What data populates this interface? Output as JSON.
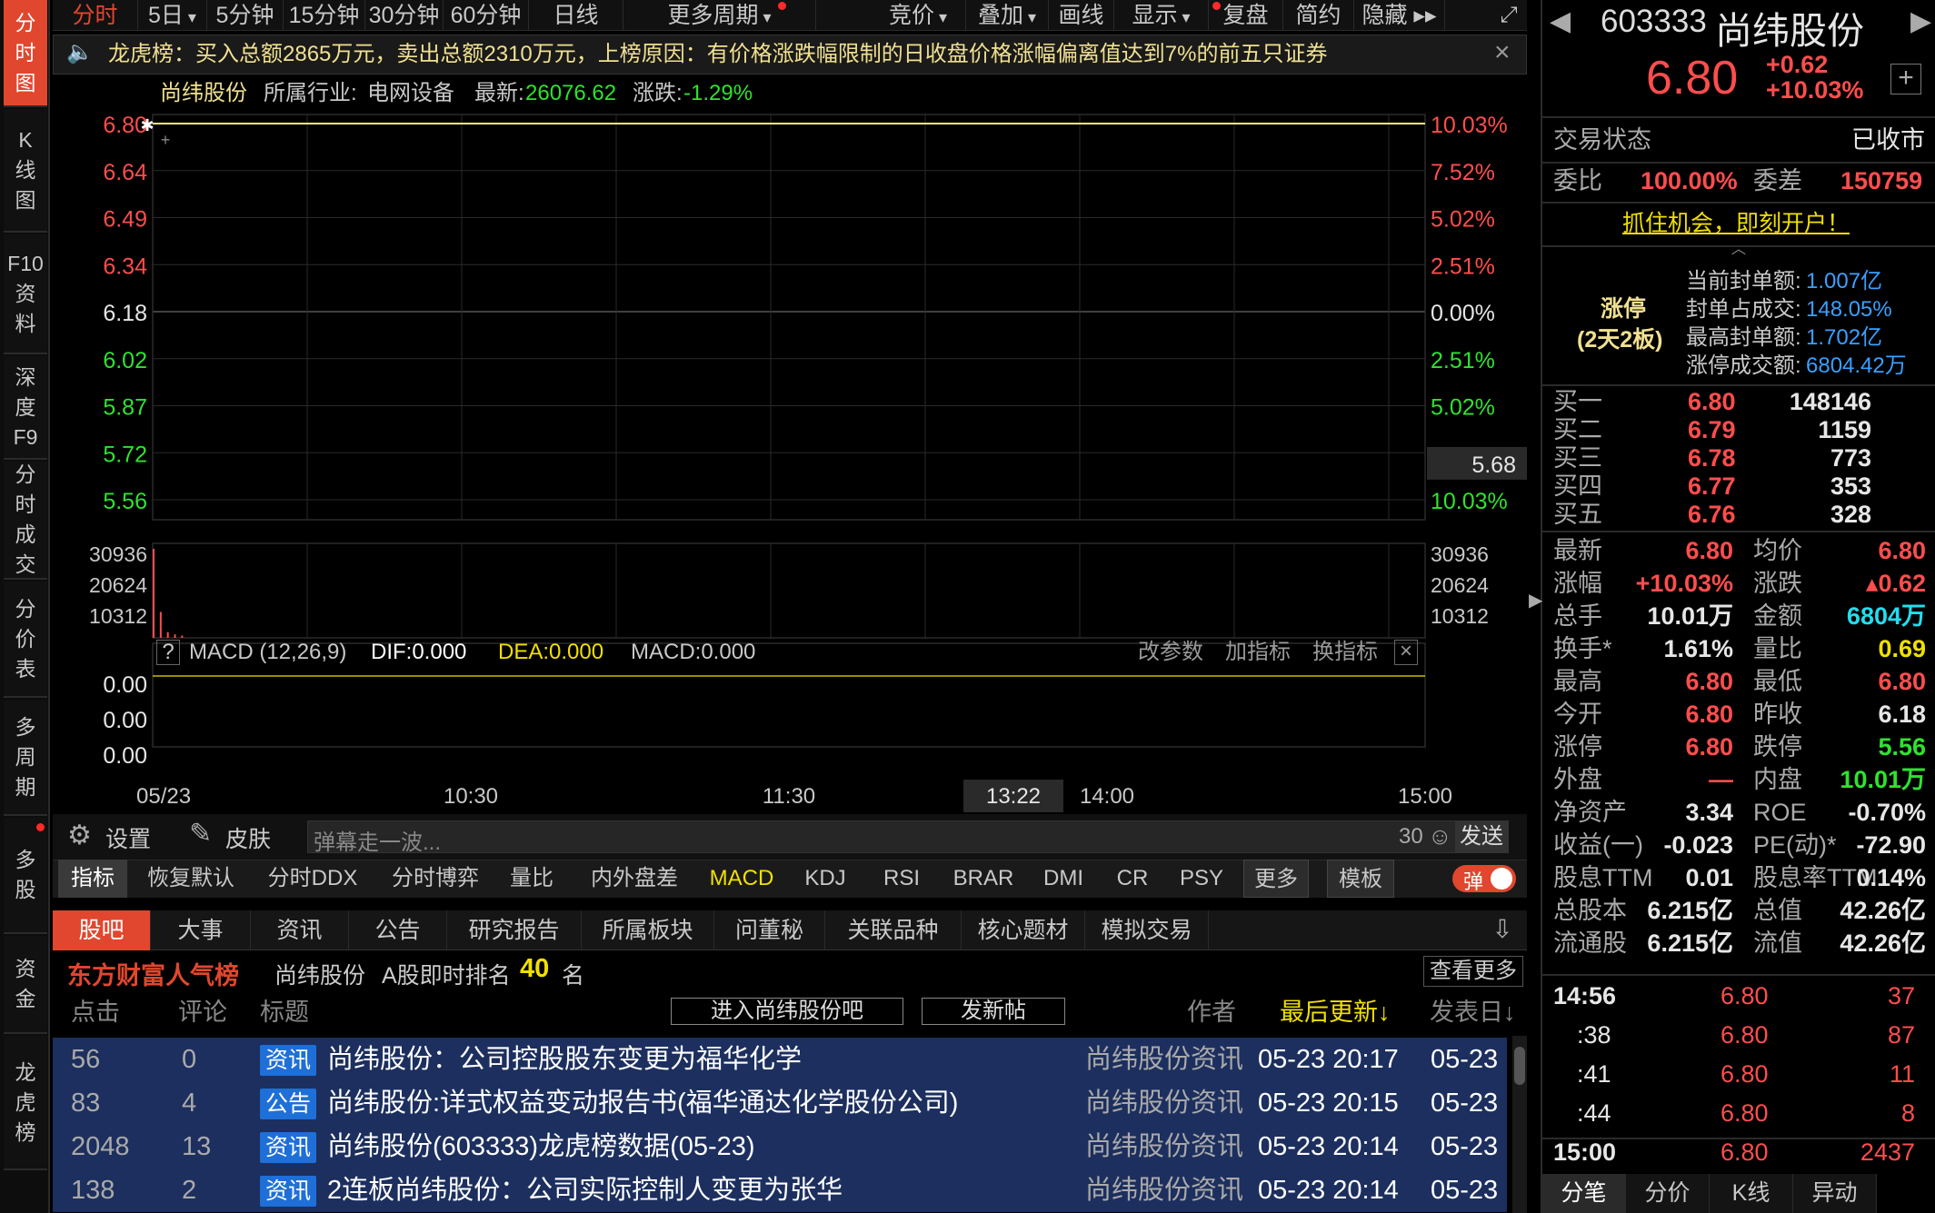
{
  "leftnav": [
    {
      "label": "分\n时\n图",
      "active": true
    },
    {
      "label": "K\n线\n图",
      "active": false
    },
    {
      "label": "F10\n资\n料",
      "active": false
    },
    {
      "label": "深\n度\nF9",
      "active": false
    },
    {
      "label": "分\n时\n成\n交",
      "active": false
    },
    {
      "label": "分\n价\n表",
      "active": false
    },
    {
      "label": "多\n周\n期",
      "active": false
    },
    {
      "label": "多\n股",
      "active": false
    },
    {
      "label": "资\n金",
      "active": false
    },
    {
      "label": "龙\n虎\n榜",
      "active": false
    }
  ],
  "toolbar": {
    "items": [
      "分时",
      "5日",
      "5分钟",
      "15分钟",
      "30分钟",
      "60分钟",
      "日线",
      "更多周期",
      "竞价",
      "叠加",
      "画线",
      "显示",
      "复盘",
      "简约",
      "隐藏 ▸▸"
    ],
    "active_index": 0
  },
  "banner": {
    "text": "龙虎榜：买入总额2865万元，卖出总额2310万元，上榜原因：有价格涨跌幅限制的日收盘价格涨幅偏离值达到7%的前五只证券"
  },
  "chart_header": {
    "name": "尚纬股份",
    "industry_label": "所属行业:",
    "industry": "电网设备",
    "latest_label": "最新:",
    "latest": "26076.62",
    "change_label": "涨跌:",
    "change": "-1.29%"
  },
  "chart_data": {
    "type": "line",
    "title": "尚纬股份 分时图",
    "y_price_ticks": [
      "6.80",
      "6.64",
      "6.49",
      "6.34",
      "6.18",
      "6.02",
      "5.87",
      "5.72",
      "5.56"
    ],
    "y_pct_ticks": [
      "10.03%",
      "7.52%",
      "5.02%",
      "2.51%",
      "0.00%",
      "2.51%",
      "5.02%",
      "10.03%"
    ],
    "ylim": [
      5.56,
      6.8
    ],
    "prev_close": 6.18,
    "price_series": [
      {
        "time": "09:30",
        "price": 6.8
      },
      {
        "time": "15:00",
        "price": 6.8
      }
    ],
    "cursor_price": "5.68",
    "volume_ticks": [
      "30936",
      "20624",
      "10312"
    ],
    "volume_max": 30936,
    "volume_bars": [
      {
        "time": "09:30",
        "value": 30936
      },
      {
        "time": "09:31",
        "value": 9000
      },
      {
        "time": "09:32",
        "value": 2000
      },
      {
        "time": "09:33",
        "value": 1200
      },
      {
        "time": "09:34",
        "value": 800
      }
    ],
    "macd_ticks": [
      "0.00",
      "0.00",
      "0.00"
    ],
    "macd_label": "MACD (12,26,9)",
    "dif": "DIF:0.000",
    "dea": "DEA:0.000",
    "macd": "MACD:0.000",
    "macd_links": [
      "改参数",
      "加指标",
      "换指标"
    ],
    "x_ticks": [
      "05/23",
      "10:30",
      "11:30",
      "14:00",
      "15:00"
    ],
    "x_cursor": "13:22"
  },
  "bottombar": {
    "settings": "设置",
    "skin": "皮肤",
    "danmu_placeholder": "弹幕走一波...",
    "count": "30",
    "send": "发送"
  },
  "indicators": {
    "items": [
      "指标",
      "恢复默认",
      "分时DDX",
      "分时博弈",
      "量比",
      "内外盘差",
      "MACD",
      "KDJ",
      "RSI",
      "BRAR",
      "DMI",
      "CR",
      "PSY",
      "更多",
      "模板"
    ],
    "active": "MACD",
    "toggle_label": "弹"
  },
  "news_tabs": {
    "items": [
      "股吧",
      "大事",
      "资讯",
      "公告",
      "研究报告",
      "所属板块",
      "问董秘",
      "关联品种",
      "核心题材",
      "模拟交易"
    ],
    "active_index": 0
  },
  "popularity": {
    "brand": "东方财富人气榜",
    "stock": "尚纬股份",
    "rank_label": "A股即时排名",
    "rank": "40",
    "rank_unit": "名",
    "more": "查看更多"
  },
  "news_header": {
    "clicks": "点击",
    "comments": "评论",
    "title": "标题",
    "enter_bar": "进入尚纬股份吧",
    "post": "发新帖",
    "author": "作者",
    "last_update": "最后更新↓",
    "post_date": "发表日↓"
  },
  "news_rows": [
    {
      "clicks": "56",
      "comments": "0",
      "tag": "资讯",
      "title": "尚纬股份：公司控股股东变更为福华化学",
      "author": "尚纬股份资讯",
      "updated": "05-23 20:17",
      "date": "05-23"
    },
    {
      "clicks": "83",
      "comments": "4",
      "tag": "公告",
      "title": "尚纬股份:详式权益变动报告书(福华通达化学股份公司)",
      "author": "尚纬股份资讯",
      "updated": "05-23 20:15",
      "date": "05-23"
    },
    {
      "clicks": "2048",
      "comments": "13",
      "tag": "资讯",
      "title": "尚纬股份(603333)龙虎榜数据(05-23)",
      "author": "尚纬股份资讯",
      "updated": "05-23 20:14",
      "date": "05-23"
    },
    {
      "clicks": "138",
      "comments": "2",
      "tag": "资讯",
      "title": "2连板尚纬股份：公司实际控制人变更为张华",
      "author": "尚纬股份资讯",
      "updated": "05-23 20:14",
      "date": "05-23"
    }
  ],
  "quote": {
    "code": "603333",
    "name": "尚纬股份",
    "price": "6.80",
    "change": "+0.62",
    "pct": "+10.03%",
    "status_label": "交易状态",
    "status": "已收市",
    "weibi_label": "委比",
    "weibi": "100.00%",
    "weicha_label": "委差",
    "weicha": "150759",
    "promo": "抓住机会，即刻开户！",
    "limit_label": "涨停",
    "limit_days": "(2天2板)",
    "seal": [
      {
        "label": "当前封单额:",
        "value": "1.007亿"
      },
      {
        "label": "封单占成交:",
        "value": "148.05%"
      },
      {
        "label": "最高封单额:",
        "value": "1.702亿"
      },
      {
        "label": "涨停成交额:",
        "value": "6804.42万"
      }
    ],
    "bids": [
      {
        "label": "买一",
        "price": "6.80",
        "vol": "148146"
      },
      {
        "label": "买二",
        "price": "6.79",
        "vol": "1159"
      },
      {
        "label": "买三",
        "price": "6.78",
        "vol": "773"
      },
      {
        "label": "买四",
        "price": "6.77",
        "vol": "353"
      },
      {
        "label": "买五",
        "price": "6.76",
        "vol": "328"
      }
    ],
    "stats": [
      {
        "l1": "最新",
        "v1": "6.80",
        "c1": "red",
        "l2": "均价",
        "v2": "6.80",
        "c2": "red"
      },
      {
        "l1": "涨幅",
        "v1": "+10.03%",
        "c1": "red",
        "l2": "涨跌",
        "v2": "▴0.62",
        "c2": "red"
      },
      {
        "l1": "总手",
        "v1": "10.01万",
        "c1": "wht",
        "l2": "金额",
        "v2": "6804万",
        "c2": "cyn"
      },
      {
        "l1": "换手*",
        "v1": "1.61%",
        "c1": "wht",
        "l2": "量比",
        "v2": "0.69",
        "c2": "ylw"
      },
      {
        "l1": "最高",
        "v1": "6.80",
        "c1": "red",
        "l2": "最低",
        "v2": "6.80",
        "c2": "red"
      },
      {
        "l1": "今开",
        "v1": "6.80",
        "c1": "red",
        "l2": "昨收",
        "v2": "6.18",
        "c2": "wht"
      },
      {
        "l1": "涨停",
        "v1": "6.80",
        "c1": "red",
        "l2": "跌停",
        "v2": "5.56",
        "c2": "grn"
      },
      {
        "l1": "外盘",
        "v1": "—",
        "c1": "red",
        "l2": "内盘",
        "v2": "10.01万",
        "c2": "grn"
      },
      {
        "l1": "净资产",
        "v1": "3.34",
        "c1": "wht",
        "l2": "ROE",
        "v2": "-0.70%",
        "c2": "wht"
      },
      {
        "l1": "收益(一)",
        "v1": "-0.023",
        "c1": "wht",
        "l2": "PE(动)*",
        "v2": "-72.90",
        "c2": "wht"
      },
      {
        "l1": "股息TTM",
        "v1": "0.01",
        "c1": "wht",
        "l2": "股息率TTM",
        "v2": "0.14%",
        "c2": "wht"
      },
      {
        "l1": "总股本",
        "v1": "6.215亿",
        "c1": "wht",
        "l2": "总值",
        "v2": "42.26亿",
        "c2": "wht"
      },
      {
        "l1": "流通股",
        "v1": "6.215亿",
        "c1": "wht",
        "l2": "流值",
        "v2": "42.26亿",
        "c2": "wht"
      }
    ],
    "ticks": [
      {
        "time": "14:56",
        "price": "6.80",
        "vol": "37"
      },
      {
        "time": ":38",
        "price": "6.80",
        "vol": "87"
      },
      {
        "time": ":41",
        "price": "6.80",
        "vol": "11"
      },
      {
        "time": ":44",
        "price": "6.80",
        "vol": "8"
      },
      {
        "time": "15:00",
        "price": "6.80",
        "vol": "2437"
      }
    ],
    "bottom_tabs": [
      "分笔",
      "分价",
      "K线",
      "异动"
    ]
  },
  "colors": {
    "accent": "#e0472e",
    "up": "#ff4d4d",
    "down": "#2ee32e",
    "macd_dea": "#f0e000"
  }
}
